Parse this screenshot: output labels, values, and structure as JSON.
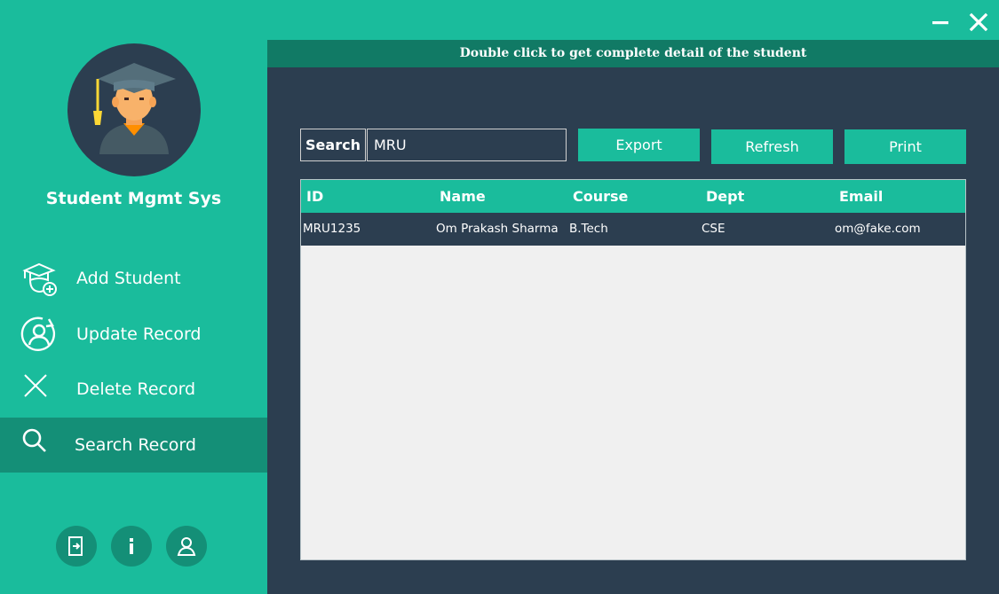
{
  "window": {
    "minimize_icon": "minimize-icon",
    "close_icon": "close-icon"
  },
  "sidebar": {
    "app_title": "Student Mgmt Sys",
    "items": [
      {
        "label": "Add Student",
        "icon": "add-student-icon",
        "active": false
      },
      {
        "label": "Update Record",
        "icon": "update-record-icon",
        "active": false
      },
      {
        "label": "Delete Record",
        "icon": "delete-record-icon",
        "active": false
      },
      {
        "label": "Search Record",
        "icon": "search-icon",
        "active": true
      }
    ],
    "footer_icons": [
      "logout-icon",
      "info-icon",
      "user-icon"
    ]
  },
  "main": {
    "banner": "Double click to get complete detail of the student",
    "search": {
      "label": "Search",
      "value": "MRU"
    },
    "buttons": {
      "export": "Export",
      "refresh": "Refresh",
      "print": "Print"
    },
    "table": {
      "columns": [
        "ID",
        "Name",
        "Course",
        "Dept",
        "Email"
      ],
      "rows": [
        [
          "MRU1235",
          "Om Prakash Sharma",
          "B.Tech",
          "CSE",
          "om@fake.com"
        ]
      ]
    }
  },
  "colors": {
    "accent": "#1abc9c",
    "accent_dark": "#148f77",
    "banner": "#117a65",
    "panel": "#2c3e50",
    "table_bg": "#f0f0f0"
  }
}
